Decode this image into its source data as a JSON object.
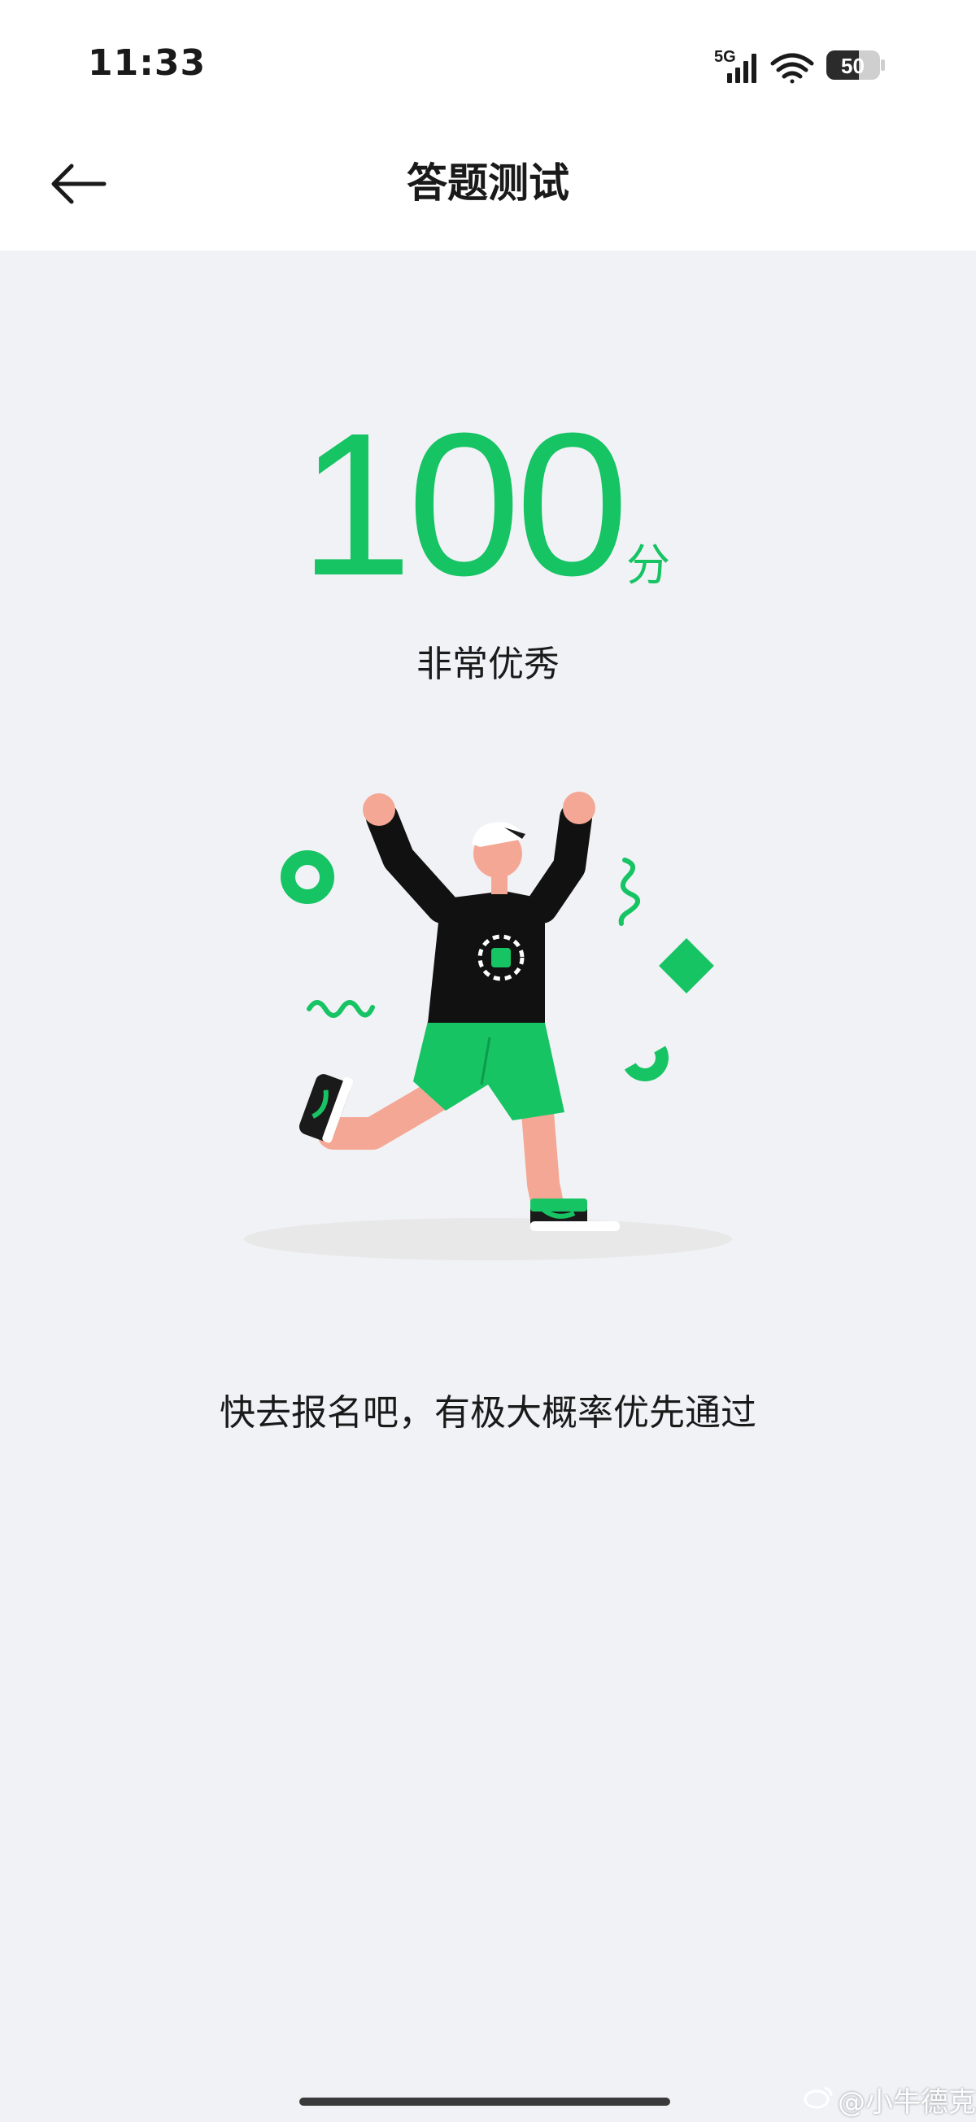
{
  "status_bar": {
    "time": "11:33",
    "network": "5G",
    "battery": "50",
    "icons": [
      "signal-icon",
      "wifi-icon",
      "battery-icon"
    ]
  },
  "header": {
    "title": "答题测试",
    "back_icon": "arrow-left-icon"
  },
  "result": {
    "score": "100",
    "unit": "分",
    "grade": "非常优秀",
    "message": "快去报名吧，有极大概率优先通过"
  },
  "illustration": {
    "name": "celebrating-runner",
    "accent_color": "#16C464"
  },
  "watermark": {
    "text": "@小牛德克"
  },
  "colors": {
    "accent": "#16C464",
    "background": "#F1F2F6",
    "surface": "#FFFFFF",
    "text": "#1A1A1A"
  }
}
